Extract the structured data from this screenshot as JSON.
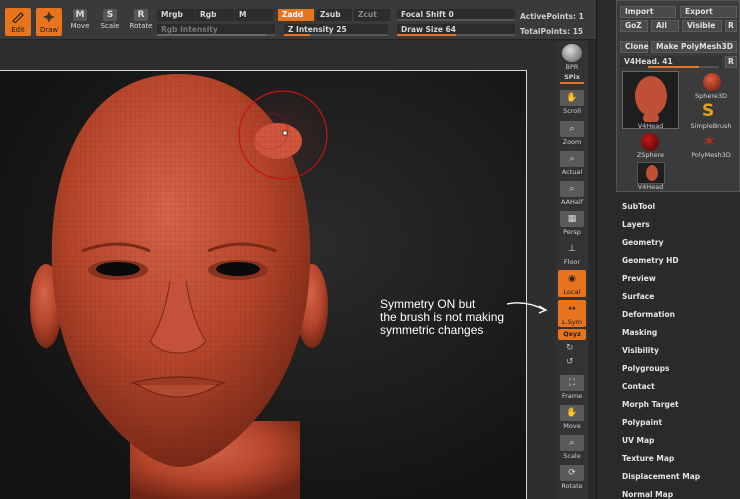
{
  "toolbar": {
    "edit": "Edit",
    "draw": "Draw",
    "move": "Move",
    "scale": "Scale",
    "rotate": "Rotate",
    "mrgb": "Mrgb",
    "rgb": "Rgb",
    "m": "M",
    "rgb_intensity": "Rgb Intensity",
    "zadd": "Zadd",
    "zsub": "Zsub",
    "zcut": "Zcut",
    "z_intensity": "Z Intensity 25",
    "z_intensity_value": 25,
    "focal_shift": "Focal Shift",
    "focal_shift_value": "0",
    "draw_size": "Draw Size 64",
    "draw_size_value": 64,
    "active_points": "ActivePoints: 1",
    "total_points": "TotalPoints: 15"
  },
  "rstrip": {
    "bpr": "BPR",
    "spix": "SPix",
    "scroll": "Scroll",
    "zoom": "Zoom",
    "actual": "Actual",
    "aahalf": "AAHalf",
    "persp": "Persp",
    "floor": "Floor",
    "local": "Local",
    "lsym": "L.Sym",
    "xyz": "Qxyz",
    "frame": "Frame",
    "move": "Move",
    "scale": "Scale",
    "rotate": "Rotate"
  },
  "toolpalette": {
    "import": "Import",
    "export": "Export",
    "goz": "GoZ",
    "all": "All",
    "visible": "Visible",
    "r": "R",
    "clone": "Clone",
    "make_polymesh": "Make PolyMesh3D",
    "current_tool": "V4Head. 41",
    "r2": "R",
    "thumbs": [
      "V4Head",
      "Sphere3D",
      "SimpleBrush",
      "ZSphere",
      "PolyMesh3D",
      "V4Head"
    ]
  },
  "menu": [
    "SubTool",
    "Layers",
    "Geometry",
    "Geometry HD",
    "Preview",
    "Surface",
    "Deformation",
    "Masking",
    "Visibility",
    "Polygroups",
    "Contact",
    "Morph Target",
    "Polypaint",
    "UV Map",
    "Texture Map",
    "Displacement Map",
    "Normal Map"
  ],
  "annotation": {
    "line1": "Symmetry ON but",
    "line2": "the brush is not making",
    "line3": "symmetric changes"
  },
  "colors": {
    "accent": "#e8741e",
    "skin": "#b8482c",
    "cursor": "#cc1111"
  }
}
